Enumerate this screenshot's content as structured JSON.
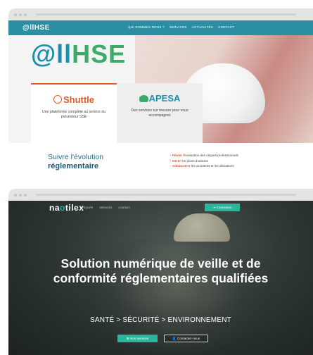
{
  "site1": {
    "logo": "@llHSE",
    "menu": [
      "QUI SOMMES-NOUS ?",
      "SERVICES",
      "ACTUALITÉS",
      "CONTACT"
    ],
    "hero_logo_a": "@ll",
    "hero_logo_hse": "HSE",
    "cards": [
      {
        "title": "Shuttle",
        "desc": "Une plateforme complète au service du préventeur SSE"
      },
      {
        "title": "APESA",
        "desc": "Des services sur mesure pour vous accompagner"
      }
    ],
    "suivre_line1": "Suivre l'évolution",
    "suivre_line2": "réglementaire",
    "bullets": [
      {
        "bold": "Piloter",
        "rest": " l'évaluation des risques professionnels"
      },
      {
        "bold": "Gérer",
        "rest": " les plans d'actions"
      },
      {
        "bold": "Administrer",
        "rest": " les accidents et les déviations"
      }
    ]
  },
  "site2": {
    "logo_prefix": "na",
    "logo_o": "o",
    "logo_suffix": "tilex",
    "menu": [
      "L'ÉQUIPE",
      "SERVICES",
      "CONTACT"
    ],
    "connexion": "Connexion",
    "headline": "Solution numérique de veille et de conformité réglementaires qualifiées",
    "subline": "SANTÉ  >  SÉCURITÉ  >  ENVIRONNEMENT",
    "btn_services": "Nos services",
    "btn_contact": "Contactez-nous"
  },
  "colors": {
    "teal": "#2a8fa3",
    "orange": "#e9562a",
    "green": "#3cab6a",
    "mint": "#2bb59a"
  }
}
